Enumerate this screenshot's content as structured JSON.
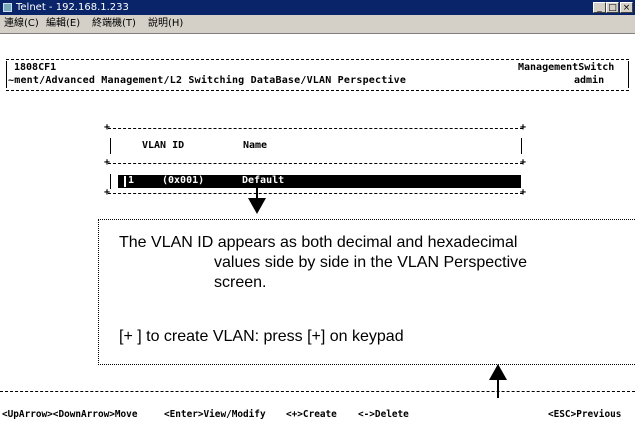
{
  "window": {
    "title": "Telnet - 192.168.1.233"
  },
  "menu": [
    "連線(C)",
    "編輯(E)",
    "終端機(T)",
    "說明(H)"
  ],
  "header": {
    "device": "1808CF1",
    "right_title": "ManagementSwitch",
    "path": "~ment/Advanced Management/L2 Switching DataBase/VLAN Perspective",
    "user": "admin"
  },
  "table": {
    "col_vlan_id": "VLAN ID",
    "col_name": "Name",
    "row_vlan": "1",
    "row_hex": "(0x001)",
    "row_name": "Default"
  },
  "callout": {
    "line1": "The VLAN ID appears as both decimal and hexadecimal",
    "line2": "values side by side in the VLAN Perspective",
    "line3": "screen.",
    "line4": "[+ ] to create VLAN: press [+] on keypad"
  },
  "footer": {
    "nav": "<UpArrow><DownArrow>Move",
    "enter": "<Enter>View/Modify",
    "create": "<+>Create",
    "delete": "<->Delete",
    "esc": "<ESC>Previous"
  }
}
